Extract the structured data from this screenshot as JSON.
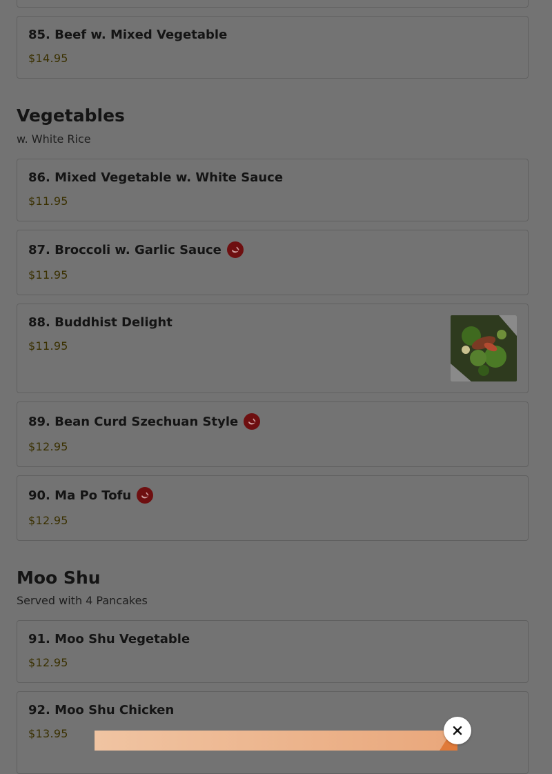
{
  "items": {
    "i84": {
      "name": "",
      "price": ""
    },
    "i85": {
      "name": "85. Beef w. Mixed Vegetable",
      "price": "$14.95"
    },
    "i86": {
      "name": "86. Mixed Vegetable w. White Sauce",
      "price": "$11.95"
    },
    "i87": {
      "name": "87. Broccoli w. Garlic Sauce",
      "price": "$11.95",
      "spicy": true
    },
    "i88": {
      "name": "88. Buddhist Delight",
      "price": "$11.95",
      "has_image": true
    },
    "i89": {
      "name": "89. Bean Curd Szechuan Style",
      "price": "$12.95",
      "spicy": true
    },
    "i90": {
      "name": "90. Ma Po Tofu",
      "price": "$12.95",
      "spicy": true
    },
    "i91": {
      "name": "91. Moo Shu Vegetable",
      "price": "$12.95"
    },
    "i92": {
      "name": "92. Moo Shu Chicken",
      "price": "$13.95"
    }
  },
  "sections": {
    "vegetables": {
      "title": "Vegetables",
      "subtitle": "w. White Rice"
    },
    "mooshu": {
      "title": "Moo Shu",
      "subtitle": "Served with 4 Pancakes"
    }
  },
  "icons": {
    "spicy": "chili-pepper-icon",
    "close": "close-icon"
  },
  "colors": {
    "overlay_bg": "#737373",
    "spicy_badge": "#6e0f10",
    "price_text": "#3a3000"
  }
}
